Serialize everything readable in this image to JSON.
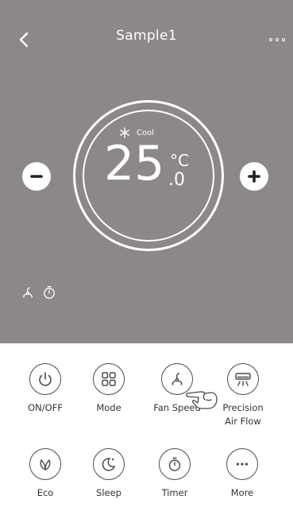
{
  "header": {
    "title": "Sample1",
    "back_icon": "chevron-left-icon",
    "menu_icon": "more-dots-icon"
  },
  "thermostat": {
    "mode_icon": "snowflake-icon",
    "mode": "Cool",
    "temperature": "25",
    "unit": "°C",
    "decimal": ".0"
  },
  "status_icons": [
    "fan-icon",
    "timer-icon"
  ],
  "functions": [
    {
      "label": "ON/OFF",
      "icon": "power-icon"
    },
    {
      "label": "Mode",
      "icon": "mode-grid-icon"
    },
    {
      "label": "Fan Speed",
      "icon": "fan-icon"
    },
    {
      "label": "Precision\nAir Flow",
      "icon": "air-flow-icon"
    },
    {
      "label": "Eco",
      "icon": "leaf-icon"
    },
    {
      "label": "Sleep",
      "icon": "moon-icon"
    },
    {
      "label": "Timer",
      "icon": "timer-icon"
    },
    {
      "label": "More",
      "icon": "ellipsis-icon"
    }
  ],
  "colors": {
    "header_bg": "#8c8888",
    "accent": "#ffffff",
    "icon_stroke": "#4a4a4a"
  }
}
